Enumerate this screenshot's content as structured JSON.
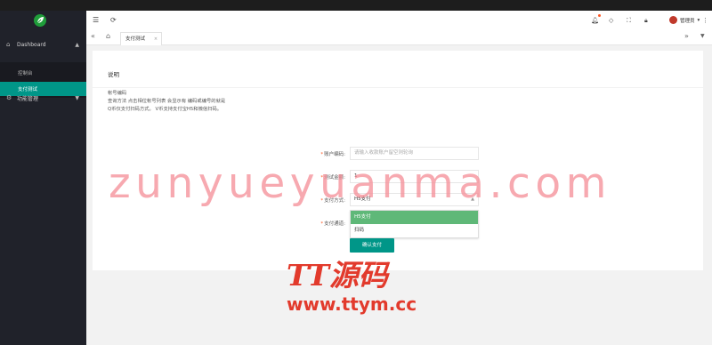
{
  "sidebar": {
    "logo_icon": "leaf-logo-icon",
    "groups": [
      {
        "label": "Dashboard",
        "icon": "home-icon",
        "expanded": true
      },
      {
        "label": "功能管理",
        "icon": "gear-icon",
        "expanded": false
      }
    ],
    "items": [
      {
        "label": "控制台",
        "active": false
      },
      {
        "label": "支付测试",
        "active": true
      }
    ]
  },
  "header": {
    "menu_icon": "hamburger-icon",
    "refresh_icon": "refresh-icon",
    "right_icons": [
      "bell-icon",
      "tag-icon",
      "fullscreen-icon",
      "lock-icon"
    ],
    "admin_label": "管理员",
    "admin_caret": "▾",
    "more_icon": "more-vertical-icon"
  },
  "tabs": {
    "prev_icon": "double-left-icon",
    "home_icon": "home-icon",
    "items": [
      {
        "label": "支付测试",
        "close": "×"
      }
    ],
    "next_icon": "double-right-icon",
    "dropdown_icon": "chevron-down-icon"
  },
  "main": {
    "card_title": "说明",
    "desc_lines": [
      "帐号编码",
      "查询方法 点击相位帐号列表 会显示有 编码或编号的就是",
      "Q币仅支付扫码方式。 V币支持支付宝H5和微信扫码。"
    ],
    "form": {
      "account_label": "账户编码:",
      "account_placeholder": "请输入收款账户留空则轮询",
      "amount_label": "测试金额:",
      "amount_value": "1",
      "method_label": "支付方式:",
      "method_value": "H5支付",
      "channel_label": "支付通道:",
      "options": [
        "H5支付",
        "扫码"
      ],
      "submit_label": "确认支付",
      "required_mark": "*"
    }
  },
  "watermark": {
    "domain": "zunyueyuanma.com",
    "brand": "TT源码",
    "url": "www.ttym.cc"
  },
  "colors": {
    "accent": "#009688",
    "option_selected": "#5fb878",
    "sidebar_bg": "#20222a",
    "watermark_red": "#e23a2c"
  }
}
